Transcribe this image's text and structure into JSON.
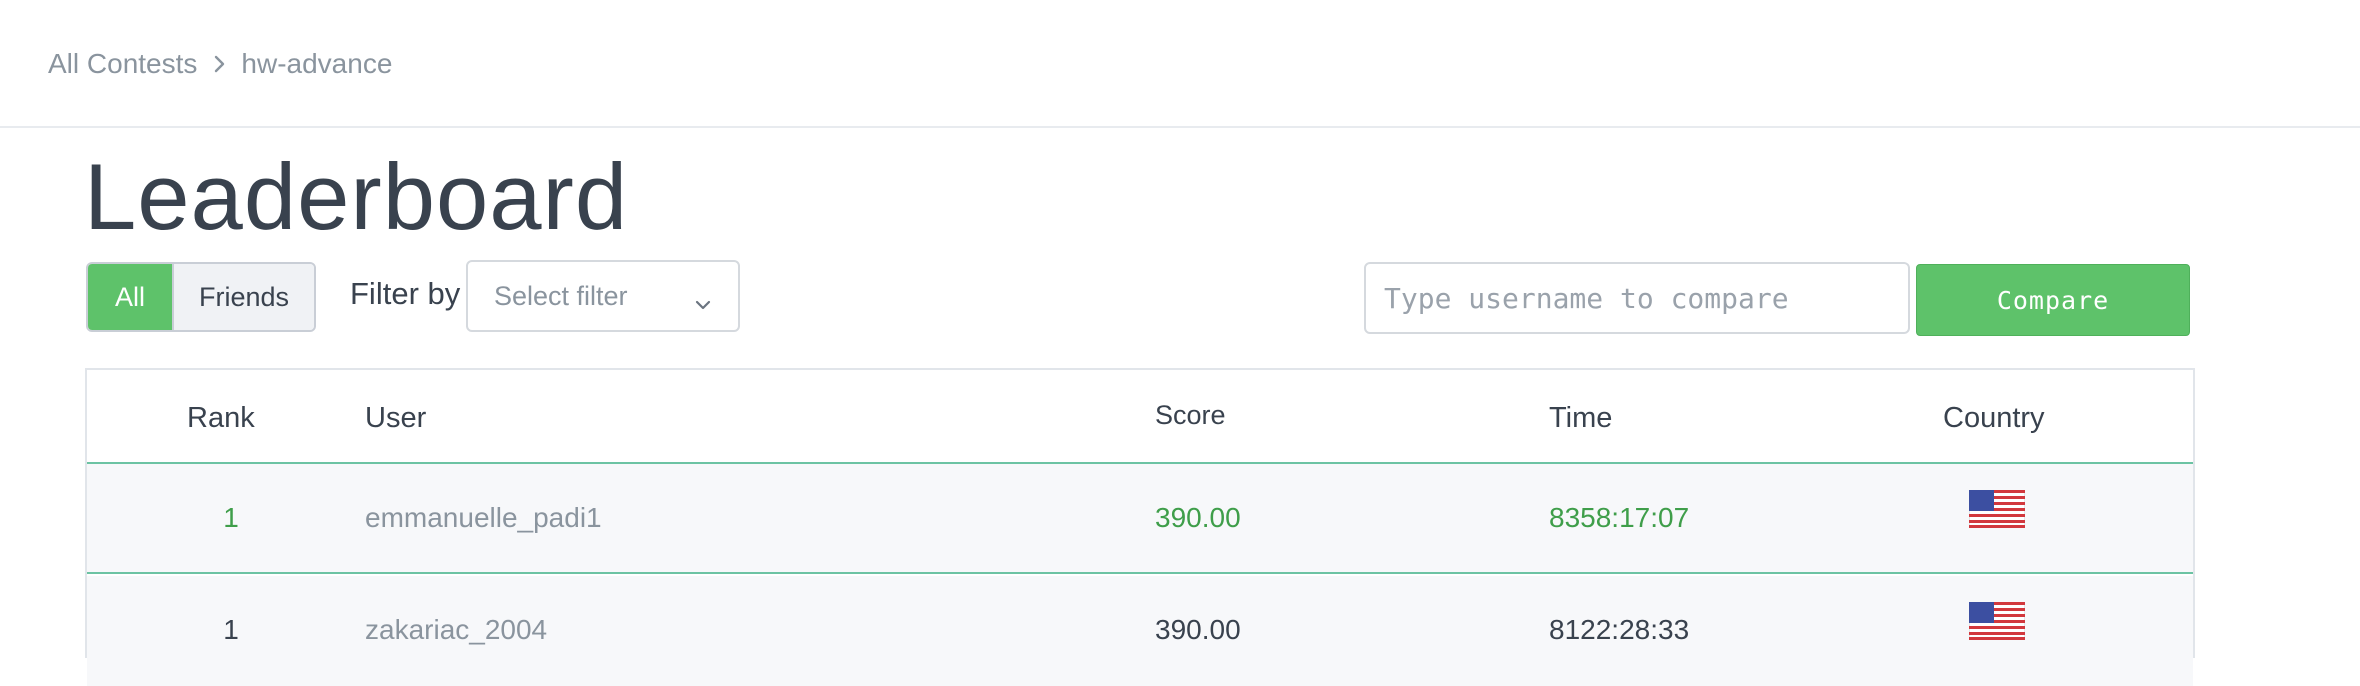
{
  "breadcrumb": {
    "root": "All Contests",
    "current": "hw-advance"
  },
  "page": {
    "title": "Leaderboard"
  },
  "controls": {
    "toggle_all": "All",
    "toggle_friends": "Friends",
    "filter_label": "Filter by",
    "filter_selected": "Select filter",
    "compare_placeholder": "Type username to compare",
    "compare_button": "Compare"
  },
  "table": {
    "columns": {
      "rank": "Rank",
      "user": "User",
      "score": "Score",
      "time": "Time",
      "country": "Country"
    },
    "rows": [
      {
        "rank": "1",
        "user": "emmanuelle_padi1",
        "score": "390.00",
        "time": "8358:17:07",
        "country_icon": "us-flag-icon",
        "highlighted": true
      },
      {
        "rank": "1",
        "user": "zakariac_2004",
        "score": "390.00",
        "time": "8122:28:33",
        "country_icon": "us-flag-icon",
        "highlighted": false
      }
    ]
  },
  "colors": {
    "accent_green": "#5ec26a",
    "highlight_text": "#3f9e4a",
    "row_divider": "#6cc3a3",
    "text_dark": "#39424e",
    "text_muted": "#8a949e"
  }
}
